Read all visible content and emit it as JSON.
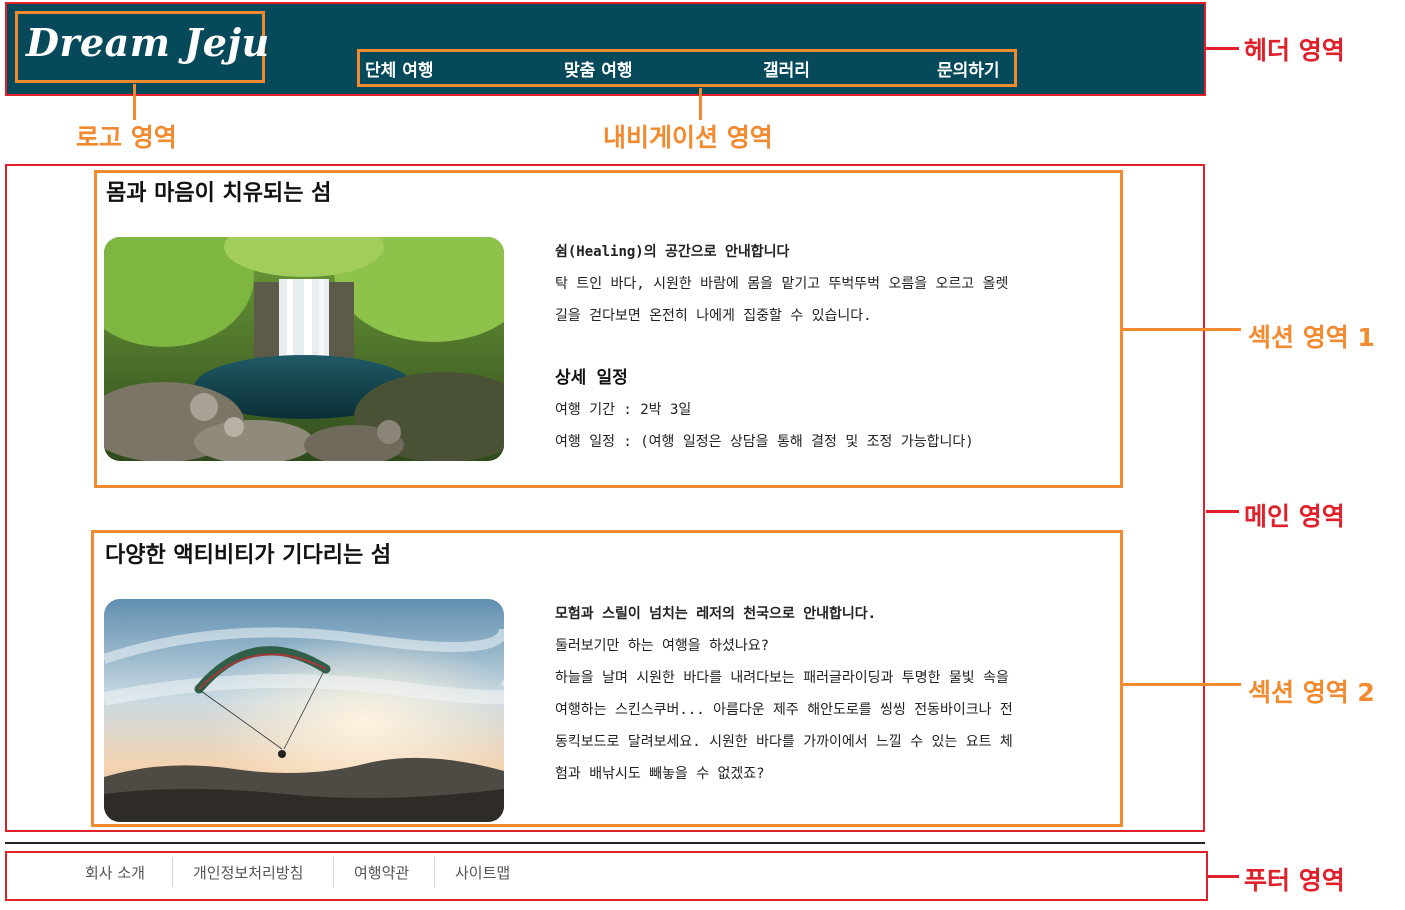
{
  "header": {
    "logo": "Dream Jeju",
    "nav": [
      "단체 여행",
      "맞춤 여행",
      "갤러리",
      "문의하기"
    ]
  },
  "annotations": {
    "header": "헤더 영역",
    "logo": "로고 영역",
    "nav": "내비게이션 영역",
    "section1": "섹션 영역 1",
    "main": "메인 영역",
    "section2": "섹션 영역 2",
    "footer": "푸터 영역"
  },
  "sections": [
    {
      "title": "몸과 마음이 치유되는 섬",
      "lead": "쉼(Healing)의 공간으로 안내합니다",
      "lines": [
        "탁 트인 바다, 시원한 바람에 몸을 맡기고 뚜벅뚜벅 오름을 오르고 올렛",
        "길을 걷다보면 온전히 나에게 집중할 수 있습니다."
      ],
      "subtitle": "상세 일정",
      "details": [
        "여행 기간 : 2박 3일",
        "여행 일정 : (여행 일정은 상담을 통해 결정 및 조정 가능합니다)"
      ]
    },
    {
      "title": "다양한 액티비티가 기다리는 섬",
      "lead": "모험과 스릴이 넘치는 레저의 천국으로 안내합니다.",
      "lines": [
        "둘러보기만 하는 여행을 하셨나요?",
        "하늘을 날며 시원한 바다를 내려다보는 패러글라이딩과 투명한 물빛 속을",
        "여행하는 스킨스쿠버... 아름다운 제주 해안도로를 씽씽 전동바이크나 전",
        "동킥보드로 달려보세요. 시원한 바다를 가까이에서 느낄 수 있는 요트 체",
        "험과 배낚시도 빼놓을 수 없겠죠?"
      ]
    }
  ],
  "footer": {
    "links": [
      "회사 소개",
      "개인정보처리방침",
      "여행약관",
      "사이트맵"
    ]
  },
  "colors": {
    "header_bg": "#05495a",
    "annotation_red": "#e0202a",
    "annotation_orange": "#f28a30"
  }
}
